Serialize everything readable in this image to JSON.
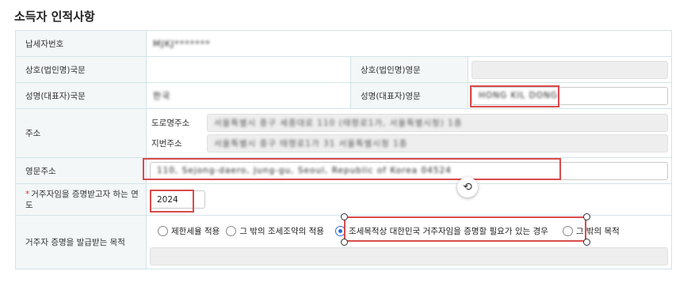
{
  "section": {
    "title": "소득자 인적사항"
  },
  "rows": {
    "tax_id": {
      "label": "납세자번호",
      "value": "MJKJ*******"
    },
    "company": {
      "label_kr": "상호(법인명)국문",
      "value_kr": "",
      "label_en": "상호(법인명)영문",
      "value_en": ""
    },
    "name": {
      "label_kr": "성명(대표자)국문",
      "value_kr": "한국",
      "label_en": "성명(대표자)영문",
      "value_en": "HONG KIL DONG"
    },
    "address": {
      "label": "주소",
      "road_label": "도로명주소",
      "road_value": "서울특별시 중구 세종대로 110 (태평로1가, 서울특별시청) 1층",
      "lot_label": "지번주소",
      "lot_value": "서울특별시 중구 태평로1가 31 서울특별시청 1층"
    },
    "en_address": {
      "label": "영문주소",
      "value": "110, Sejong-daero, Jung-gu, Seoul, Republic of Korea 04524"
    },
    "year": {
      "required_mark": "*",
      "label": "거주자임을 증명받고자 하는 연도",
      "value": "2024"
    },
    "purpose": {
      "label": "거주자 증명을 발급받는 목적",
      "options": [
        {
          "label": "제한세율 적용",
          "checked": false
        },
        {
          "label": "그 밖의 조세조약의 적용",
          "checked": false
        },
        {
          "label": "조세목적상 대한민국 거주자임을 증명할 필요가 있는 경우",
          "checked": true
        },
        {
          "label": "그 밖의 목적",
          "checked": false
        }
      ],
      "other_value": ""
    }
  },
  "colors": {
    "highlight": "#d94b4b",
    "radio_selected": "#2a6fd6",
    "label_bg": "#f3f7f8"
  },
  "icons": {
    "cursor": "rotate-cursor-icon"
  }
}
